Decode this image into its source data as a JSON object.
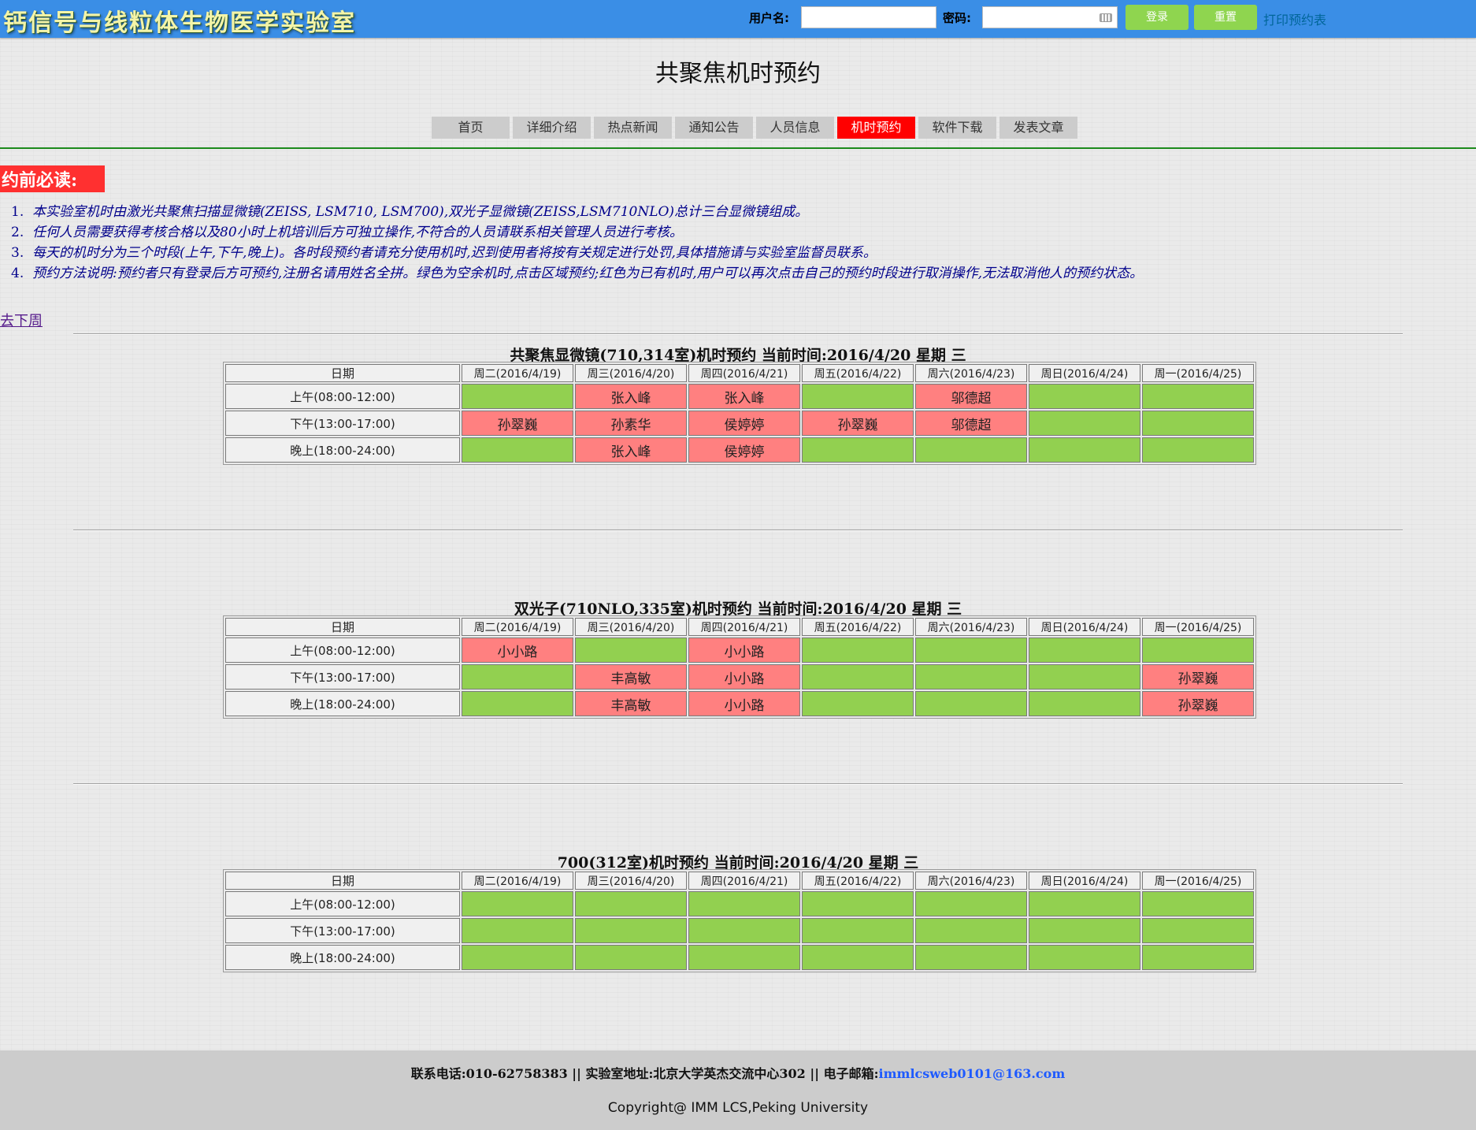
{
  "header": {
    "logo_text": "钙信号与线粒体生物医学实验室",
    "username_label": "用户名:",
    "password_label": "密码:",
    "username_value": "",
    "password_value": "",
    "login_button": "登录",
    "reset_button": "重置",
    "print_link": "打印预约表"
  },
  "page_title": "共聚焦机时预约",
  "nav": {
    "items": [
      "首页",
      "详细介绍",
      "热点新闻",
      "通知公告",
      "人员信息",
      "机时预约",
      "软件下载",
      "发表文章"
    ],
    "active": "机时预约",
    "active_color": "#ff0000"
  },
  "notice": {
    "title": "约前必读:",
    "items": [
      {
        "num": "1.",
        "text": "本实验室机时由激光共聚焦扫描显微镜(ZEISS, LSM710, LSM700),双光子显微镜(ZEISS,LSM710NLO)总计三台显微镜组成。"
      },
      {
        "num": "2.",
        "text": "任何人员需要获得考核合格以及80小时上机培训后方可独立操作,不符合的人员请联系相关管理人员进行考核。"
      },
      {
        "num": "3.",
        "text": "每天的机时分为三个时段(上午,下午,晚上)。各时段预约者请充分使用机时,迟到使用者将按有关规定进行处罚,具体措施请与实验室监督员联系。"
      },
      {
        "num": "4.",
        "text": "预约方法说明:预约者只有登录后方可预约,注册名请用姓名全拼。绿色为空余机时,点击区域预约;红色为已有机时,用户可以再次点击自己的预约时段进行取消操作,无法取消他人的预约状态。"
      }
    ]
  },
  "next_week_link": "去下周",
  "colors": {
    "free": "#92d050",
    "booked": "#ff8080",
    "topbar": "#3a8ee6"
  },
  "schedules": [
    {
      "title": "共聚焦显微镜(710,314室)机时预约 当前时间:2016/4/20 星期 三",
      "header": [
        "日期",
        "周二(2016/4/19)",
        "周三(2016/4/20)",
        "周四(2016/4/21)",
        "周五(2016/4/22)",
        "周六(2016/4/23)",
        "周日(2016/4/24)",
        "周一(2016/4/25)"
      ],
      "rows": [
        {
          "slot": "上午(08:00-12:00)",
          "cells": [
            "",
            "张入峰",
            "张入峰",
            "",
            "邬德超",
            "",
            ""
          ]
        },
        {
          "slot": "下午(13:00-17:00)",
          "cells": [
            "孙翠巍",
            "孙素华",
            "侯婷婷",
            "孙翠巍",
            "邬德超",
            "",
            ""
          ]
        },
        {
          "slot": "晚上(18:00-24:00)",
          "cells": [
            "",
            "张入峰",
            "侯婷婷",
            "",
            "",
            "",
            ""
          ]
        }
      ]
    },
    {
      "title": "双光子(710NLO,335室)机时预约 当前时间:2016/4/20 星期 三",
      "header": [
        "日期",
        "周二(2016/4/19)",
        "周三(2016/4/20)",
        "周四(2016/4/21)",
        "周五(2016/4/22)",
        "周六(2016/4/23)",
        "周日(2016/4/24)",
        "周一(2016/4/25)"
      ],
      "rows": [
        {
          "slot": "上午(08:00-12:00)",
          "cells": [
            "小小路",
            "",
            "小小路",
            "",
            "",
            "",
            ""
          ]
        },
        {
          "slot": "下午(13:00-17:00)",
          "cells": [
            "",
            "丰高敏",
            "小小路",
            "",
            "",
            "",
            "孙翠巍"
          ]
        },
        {
          "slot": "晚上(18:00-24:00)",
          "cells": [
            "",
            "丰高敏",
            "小小路",
            "",
            "",
            "",
            "孙翠巍"
          ]
        }
      ]
    },
    {
      "title": "700(312室)机时预约 当前时间:2016/4/20 星期 三",
      "header": [
        "日期",
        "周二(2016/4/19)",
        "周三(2016/4/20)",
        "周四(2016/4/21)",
        "周五(2016/4/22)",
        "周六(2016/4/23)",
        "周日(2016/4/24)",
        "周一(2016/4/25)"
      ],
      "rows": [
        {
          "slot": "上午(08:00-12:00)",
          "cells": [
            "",
            "",
            "",
            "",
            "",
            "",
            ""
          ]
        },
        {
          "slot": "下午(13:00-17:00)",
          "cells": [
            "",
            "",
            "",
            "",
            "",
            "",
            ""
          ]
        },
        {
          "slot": "晚上(18:00-24:00)",
          "cells": [
            "",
            "",
            "",
            "",
            "",
            "",
            ""
          ]
        }
      ]
    }
  ],
  "footer": {
    "contact_prefix": "联系电话:010-62758383 || 实验室地址:北京大学英杰交流中心302 || 电子邮箱:",
    "email": "immlcsweb0101@163.com",
    "copyright": "Copyright@ IMM LCS,Peking University"
  }
}
